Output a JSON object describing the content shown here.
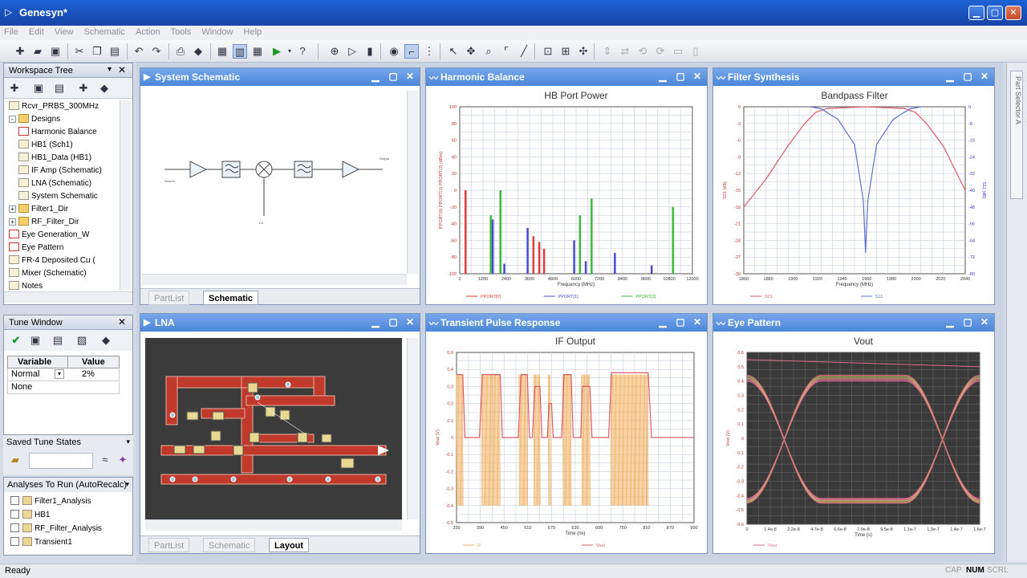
{
  "app": {
    "title": "Genesyn*"
  },
  "menu": [
    "File",
    "Edit",
    "View",
    "Schematic",
    "Action",
    "Tools",
    "Window",
    "Help"
  ],
  "workspace": {
    "title": "Workspace Tree",
    "items": [
      {
        "label": "Rcvr_PRBS_300MHz",
        "indent": 1,
        "icon": "sch"
      },
      {
        "label": "Designs",
        "indent": 1,
        "icon": "folder",
        "exp": "-"
      },
      {
        "label": "Harmonic Balance",
        "indent": 3,
        "icon": "graph"
      },
      {
        "label": "HB1 (Sch1)",
        "indent": 3,
        "icon": "sch"
      },
      {
        "label": "HB1_Data (HB1)",
        "indent": 3,
        "icon": "sch"
      },
      {
        "label": "IF Amp (Schematic)",
        "indent": 3,
        "icon": "sch"
      },
      {
        "label": "LNA (Schematic)",
        "indent": 3,
        "icon": "sch"
      },
      {
        "label": "System Schematic",
        "indent": 3,
        "icon": "sch"
      },
      {
        "label": "Filter1_Dir",
        "indent": 1,
        "icon": "folder",
        "exp": "+"
      },
      {
        "label": "RF_Filter_Dir",
        "indent": 1,
        "icon": "folder",
        "exp": "+"
      },
      {
        "label": "Eye Generation_W",
        "indent": 1,
        "icon": "graph"
      },
      {
        "label": "Eye Pattern",
        "indent": 1,
        "icon": "graph"
      },
      {
        "label": "FR-4 Deposited Cu (",
        "indent": 1,
        "icon": "sch"
      },
      {
        "label": "Mixer (Schematic)",
        "indent": 1,
        "icon": "sch"
      },
      {
        "label": "Notes",
        "indent": 1,
        "icon": "sch"
      }
    ]
  },
  "tune": {
    "title": "Tune Window",
    "col_variable": "Variable",
    "col_value": "Value",
    "row1_var": "Normal",
    "row1_val": "2%",
    "row2_var": "None",
    "saved_title": "Saved Tune States",
    "analyses_title": "Analyses To Run (AutoRecalc)",
    "analyses": [
      "Filter1_Analysis",
      "HB1",
      "RF_Filter_Analysis",
      "Transient1"
    ]
  },
  "windows": {
    "schematic": {
      "title": "System Schematic",
      "tab1": "PartList",
      "tab2": "Schematic"
    },
    "hb": {
      "title": "Harmonic Balance"
    },
    "filter": {
      "title": "Filter Synthesis"
    },
    "lna": {
      "title": "LNA",
      "tab1": "PartList",
      "tab2": "Schematic",
      "tab3": "Layout"
    },
    "transient": {
      "title": "Transient Pulse Response"
    },
    "eye": {
      "title": "Eye Pattern"
    }
  },
  "status": {
    "left": "Ready",
    "cap": "CAP",
    "num": "NUM",
    "scrl": "SCRL"
  },
  "chart_data": [
    {
      "type": "bar",
      "title": "HB Port Power",
      "xlabel": "Frequency (MHz)",
      "ylabel": "PPORT(0)  PPORT(1)  PPORT(2) (dBm)",
      "xlim": [
        0,
        12000
      ],
      "ylim": [
        -100,
        100
      ],
      "xticks": [
        0,
        1200,
        2400,
        3600,
        4800,
        6000,
        7200,
        8400,
        9600,
        10800,
        12000
      ],
      "yticks": [
        100,
        80,
        60,
        40,
        20,
        0,
        -20,
        -40,
        -60,
        -80,
        -100
      ],
      "series": [
        {
          "name": "PPORT[0]",
          "color": "#e23a3a",
          "points": [
            [
              300,
              0
            ],
            [
              3800,
              -55
            ],
            [
              4100,
              -62
            ],
            [
              4350,
              -70
            ]
          ]
        },
        {
          "name": "PPORT[1]",
          "color": "#4a4ad8",
          "points": [
            [
              1700,
              -35
            ],
            [
              2300,
              -88
            ],
            [
              3500,
              -45
            ],
            [
              5900,
              -60
            ],
            [
              6500,
              -85
            ],
            [
              8000,
              -75
            ],
            [
              9900,
              -90
            ]
          ]
        },
        {
          "name": "PPORT[2]",
          "color": "#3ab83a",
          "points": [
            [
              1600,
              -30
            ],
            [
              2100,
              0
            ],
            [
              6200,
              -30
            ],
            [
              6800,
              -10
            ],
            [
              11000,
              -20
            ]
          ]
        }
      ]
    },
    {
      "type": "line",
      "title": "Bandpass Filter",
      "xlabel": "Frequency (MHz)",
      "ylabel": "S21 (dB)",
      "ylabel2": "S11 (dB)",
      "xlim": [
        1850,
        2050
      ],
      "ylim": [
        -30,
        0
      ],
      "ylim2": [
        -80,
        0
      ],
      "xticks": [
        1860,
        1880,
        1900,
        1920,
        1940,
        1960,
        1980,
        2000,
        2020,
        2040
      ],
      "yticks": [
        0,
        -3,
        -6,
        -9,
        -12,
        -15,
        -18,
        -21,
        -24,
        -27,
        -30
      ],
      "yticks2": [
        0,
        -8,
        -16,
        -24,
        -32,
        -40,
        -48,
        -56,
        -64,
        -72,
        -80
      ],
      "series": [
        {
          "name": "S21",
          "color": "#e05a6a",
          "points": [
            [
              1850,
              -18
            ],
            [
              1870,
              -13
            ],
            [
              1890,
              -7
            ],
            [
              1905,
              -3
            ],
            [
              1915,
              -1
            ],
            [
              1925,
              -0.3
            ],
            [
              1960,
              0
            ],
            [
              1995,
              -0.3
            ],
            [
              2005,
              -1
            ],
            [
              2015,
              -3
            ],
            [
              2030,
              -7
            ],
            [
              2045,
              -13
            ],
            [
              2050,
              -15
            ]
          ]
        },
        {
          "name": "S11",
          "color": "#5b6fd6",
          "axis": "right",
          "points": [
            [
              1910,
              0
            ],
            [
              1920,
              -1
            ],
            [
              1935,
              -6
            ],
            [
              1950,
              -18
            ],
            [
              1958,
              -45
            ],
            [
              1960,
              -70
            ],
            [
              1962,
              -45
            ],
            [
              1970,
              -18
            ],
            [
              1985,
              -6
            ],
            [
              2000,
              -1
            ],
            [
              2010,
              0
            ]
          ]
        }
      ]
    },
    {
      "type": "line",
      "title": "IF Output",
      "xlabel": "Time (ns)",
      "ylabel": "Vout (V)",
      "xlim": [
        330,
        900
      ],
      "ylim": [
        -0.5,
        0.5
      ],
      "xticks": [
        330,
        390,
        450,
        510,
        570,
        630,
        690,
        750,
        810,
        870,
        900
      ],
      "yticks": [
        0.5,
        0.4,
        0.3,
        0.2,
        0.1,
        0,
        -0.1,
        -0.2,
        -0.3,
        -0.4,
        -0.5
      ],
      "series": [
        {
          "name": "IF",
          "color": "#f0b060",
          "note": "modulated carrier bursts"
        },
        {
          "name": "Vout",
          "color": "#e05a6a",
          "note": "envelope"
        }
      ]
    },
    {
      "type": "line",
      "title": "Vout",
      "xlabel": "Time (s)",
      "ylabel": "Vout (V)",
      "ylim": [
        -0.6,
        0.6
      ],
      "yticks": [
        0.6,
        0.5,
        0.4,
        0.3,
        0.2,
        0.1,
        0,
        -0.1,
        -0.2,
        -0.3,
        -0.4,
        -0.5,
        -0.6
      ],
      "xticks": [
        "0",
        "1.4e-8",
        "2.2e-8",
        "4.7e-8",
        "6.6e-8",
        "7.9e-8",
        "9.5e-8",
        "1.1e-7",
        "1.3e-7",
        "1.4e-7",
        "1.6e-7"
      ],
      "series": [
        {
          "name": "Vout",
          "color": "#e06a8a",
          "note": "eye diagram traces"
        }
      ]
    }
  ]
}
